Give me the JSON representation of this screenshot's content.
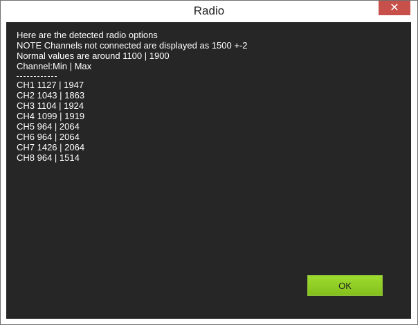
{
  "window": {
    "title": "Radio",
    "close_glyph": "✕"
  },
  "message": {
    "lines": [
      "Here are the detected radio options",
      "NOTE Channels not connected are displayed as 1500 +-2",
      "Normal values are around 1100 | 1900",
      "Channel:Min | Max"
    ],
    "channels": [
      "CH1 1127 | 1947",
      "CH2 1043 | 1863",
      "CH3 1104 | 1924",
      "CH4 1099 | 1919",
      "CH5 964 | 2064",
      "CH6 964 | 2064",
      "CH7 1426 | 2064",
      "CH8 964 | 1514"
    ]
  },
  "buttons": {
    "ok_label": "OK"
  },
  "colors": {
    "content_background": "#262626",
    "ok_button": "#8fcd23",
    "close_button": "#c7504b"
  }
}
